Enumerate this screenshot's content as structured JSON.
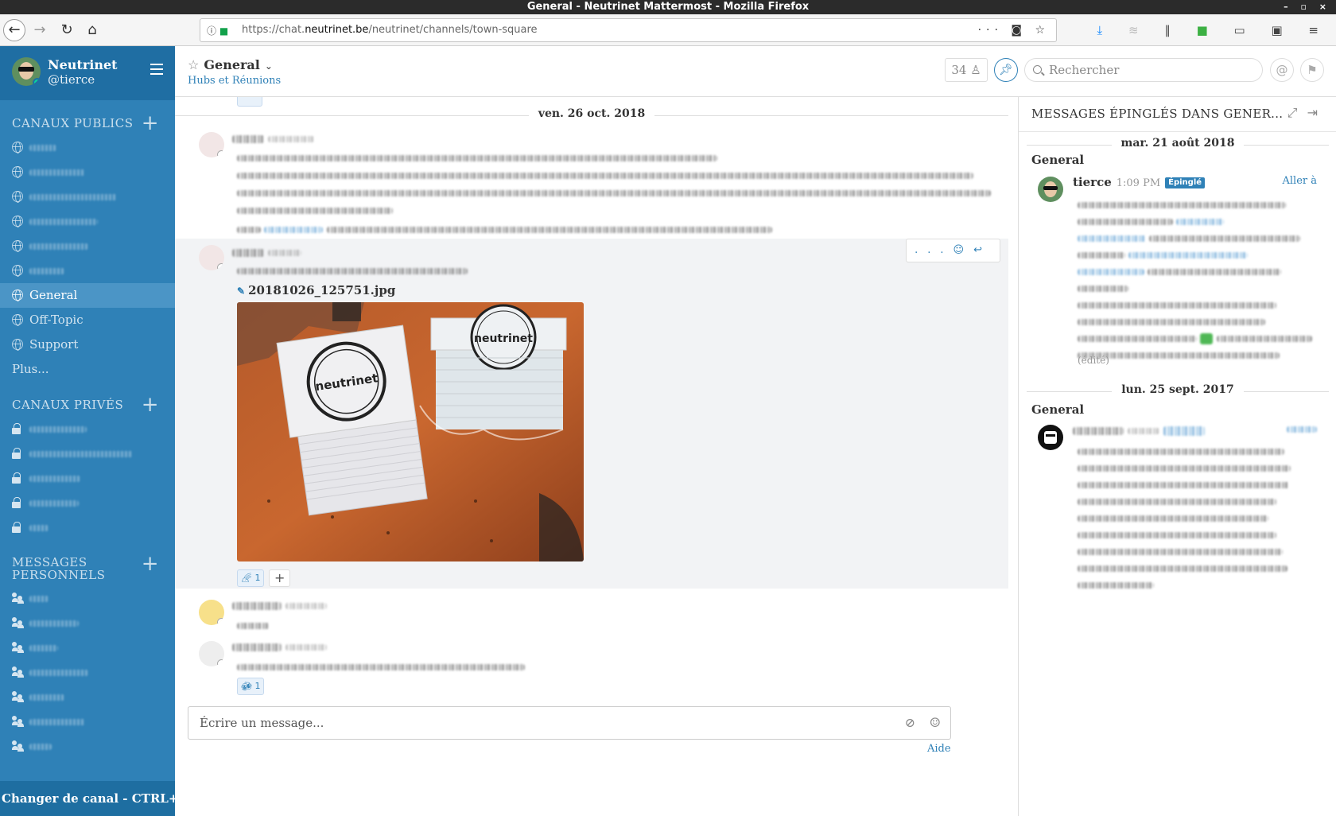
{
  "browser": {
    "window_title": "General - Neutrinet Mattermost - Mozilla Firefox",
    "url_prefix": "https://chat.",
    "url_host": "neutrinet.be",
    "url_path": "/neutrinet/channels/town-square"
  },
  "sidebar": {
    "team_name": "Neutrinet",
    "username": "@tierce",
    "public_section_title": "CANAUX PUBLICS",
    "public_channels": [
      {
        "label": "",
        "blurred": true
      },
      {
        "label": "",
        "blurred": true
      },
      {
        "label": "",
        "blurred": true
      },
      {
        "label": "",
        "blurred": true
      },
      {
        "label": "",
        "blurred": true
      },
      {
        "label": "",
        "blurred": true
      },
      {
        "label": "General",
        "active": true
      },
      {
        "label": "Off-Topic"
      },
      {
        "label": "Support"
      }
    ],
    "more_label": "Plus...",
    "private_section_title": "CANAUX PRIVÉS",
    "dm_section_title_line1": "MESSAGES",
    "dm_section_title_line2": "PERSONNELS",
    "channel_switcher": "Changer de canal - CTRL+K"
  },
  "header": {
    "channel_name": "General",
    "channel_purpose": "Hubs et Réunions",
    "member_count": "34",
    "search_placeholder": "Rechercher"
  },
  "center": {
    "date_separator": "ven. 26 oct. 2018",
    "attachment_name": "20181026_125751.jpg",
    "sticker_text": "neutrinet",
    "reaction_1_count": "1",
    "reaction_2_count": "1",
    "composer_placeholder": "Écrire un message...",
    "help_link": "Aide",
    "post_actions": "..."
  },
  "rhs": {
    "title": "MESSAGES ÉPINGLÉS DANS GENER...",
    "pinned_groups": [
      {
        "date": "mar. 21 août 2018",
        "channel": "General",
        "user": "tierce",
        "time": "1:09 PM",
        "badge": "Épinglé",
        "jump_label": "Aller à",
        "edited_label": "(édité)"
      },
      {
        "date": "lun. 25 sept. 2017",
        "channel": "General"
      }
    ]
  }
}
